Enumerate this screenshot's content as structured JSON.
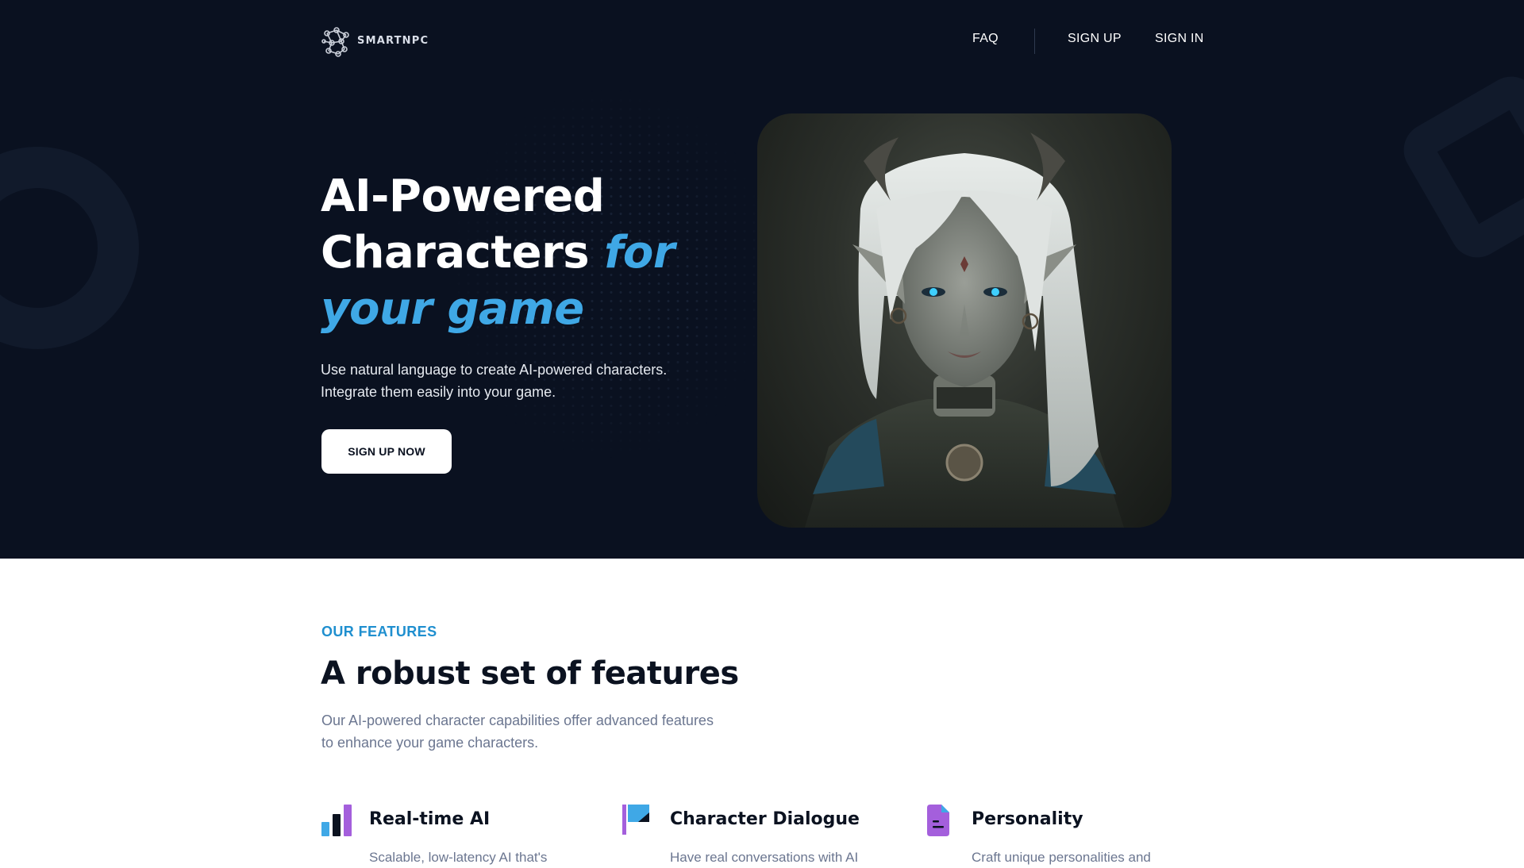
{
  "nav": {
    "logo_text": "SMARTNPC",
    "links": {
      "faq": "FAQ",
      "sign_up": "SIGN UP",
      "sign_in": "SIGN IN"
    }
  },
  "hero": {
    "title_line1": "AI-Powered",
    "title_line2": "Characters",
    "title_accent1": "for",
    "title_accent2": "your game",
    "subtitle_line1": "Use natural language to create AI-powered characters.",
    "subtitle_line2": "Integrate them easily into your game.",
    "cta_label": "SIGN UP NOW"
  },
  "features": {
    "eyebrow": "OUR FEATURES",
    "title": "A robust set of features",
    "subtitle_line1": "Our AI-powered character capabilities offer advanced features",
    "subtitle_line2": "to enhance your game characters.",
    "items": [
      {
        "title": "Real-time AI",
        "desc": "Scalable, low-latency AI that's",
        "icon": "bar-chart-icon"
      },
      {
        "title": "Character Dialogue",
        "desc": "Have real conversations with AI",
        "icon": "flag-icon"
      },
      {
        "title": "Personality",
        "desc": "Craft unique personalities and",
        "icon": "document-icon"
      }
    ]
  },
  "colors": {
    "hero_bg": "#0a1120",
    "accent": "#3fa8e6",
    "eyebrow": "#1f8fcf",
    "muted_text": "#6b7690",
    "icon_blue": "#3fa8e6",
    "icon_purple": "#a45fdc"
  }
}
